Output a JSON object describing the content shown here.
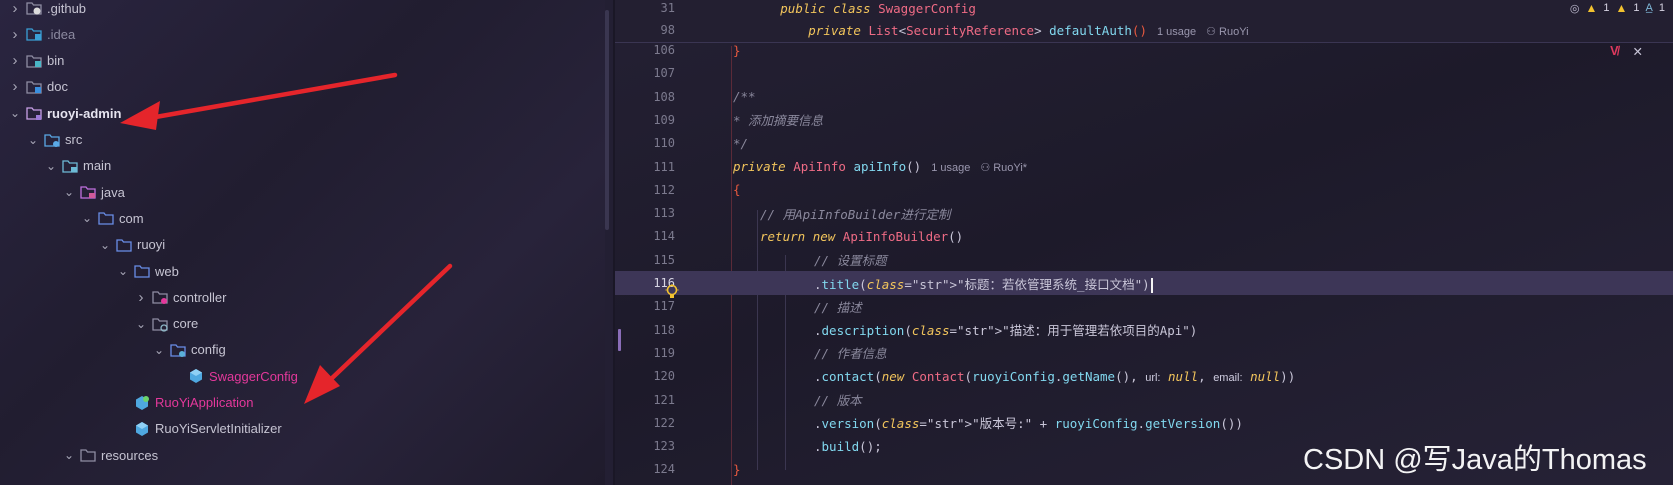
{
  "tree": {
    "items": [
      {
        "label": ".github",
        "icon": "folder-github-icon",
        "chev": "›",
        "style": "gray"
      },
      {
        "label": ".idea",
        "icon": "folder-idea-icon",
        "chev": "›",
        "style": "dim"
      },
      {
        "label": "bin",
        "icon": "folder-bin-icon",
        "chev": "›",
        "style": "gray"
      },
      {
        "label": "doc",
        "icon": "folder-doc-icon",
        "chev": "›",
        "style": "gray"
      },
      {
        "label": "ruoyi-admin",
        "icon": "module-folder-icon",
        "chev": "⌄",
        "style": "bold"
      },
      {
        "label": "src",
        "icon": "source-folder-icon",
        "chev": "⌄",
        "style": "gray"
      },
      {
        "label": "main",
        "icon": "main-folder-icon",
        "chev": "⌄",
        "style": "gray"
      },
      {
        "label": "java",
        "icon": "java-folder-icon",
        "chev": "⌄",
        "style": "gray"
      },
      {
        "label": "com",
        "icon": "package-icon",
        "chev": "⌄",
        "style": "gray"
      },
      {
        "label": "ruoyi",
        "icon": "package-icon",
        "chev": "⌄",
        "style": "gray"
      },
      {
        "label": "web",
        "icon": "package-icon",
        "chev": "⌄",
        "style": "gray"
      },
      {
        "label": "controller",
        "icon": "controller-folder-icon",
        "chev": "›",
        "style": "gray"
      },
      {
        "label": "core",
        "icon": "core-folder-icon",
        "chev": "⌄",
        "style": "gray"
      },
      {
        "label": "config",
        "icon": "config-folder-icon",
        "chev": "⌄",
        "style": "gray"
      },
      {
        "label": "SwaggerConfig",
        "icon": "class-icon",
        "chev": "",
        "style": "pink"
      },
      {
        "label": "RuoYiApplication",
        "icon": "spring-class-icon",
        "chev": "",
        "style": "pink"
      },
      {
        "label": "RuoYiServletInitializer",
        "icon": "class-icon",
        "chev": "",
        "style": "gray"
      },
      {
        "label": "resources",
        "icon": "resources-folder-icon",
        "chev": "⌄",
        "style": "gray"
      }
    ]
  },
  "editor": {
    "warnings": {
      "count_a": "1",
      "count_b": "1",
      "count_c": "1"
    },
    "sticky": [
      {
        "num": "31",
        "text": "public class SwaggerConfig"
      },
      {
        "num": "98",
        "text": "private List<SecurityReference> defaultAuth()",
        "usage": "1 usage",
        "author": "RuoYi"
      }
    ],
    "lines": [
      {
        "num": "106",
        "text": "}"
      },
      {
        "num": "107",
        "text": ""
      },
      {
        "num": "108",
        "text": "/**"
      },
      {
        "num": "109",
        "text": " * 添加摘要信息"
      },
      {
        "num": "110",
        "text": " */"
      },
      {
        "num": "111",
        "text": "private ApiInfo apiInfo()",
        "usage": "1 usage",
        "author": "RuoYi*"
      },
      {
        "num": "112",
        "text": "{"
      },
      {
        "num": "113",
        "text": "// 用ApiInfoBuilder进行定制"
      },
      {
        "num": "114",
        "text": "return new ApiInfoBuilder()"
      },
      {
        "num": "115",
        "text": "// 设置标题"
      },
      {
        "num": "116",
        "text": ".title(\"标题：若依管理系统_接口文档\")"
      },
      {
        "num": "117",
        "text": "// 描述"
      },
      {
        "num": "118",
        "text": ".description(\"描述：用于管理若依项目的Api\")"
      },
      {
        "num": "119",
        "text": "// 作者信息"
      },
      {
        "num": "120",
        "text": ".contact(new Contact(ruoyiConfig.getName(), url: null, email: null))"
      },
      {
        "num": "121",
        "text": "// 版本"
      },
      {
        "num": "122",
        "text": ".version(\"版本号:\" + ruoyiConfig.getVersion())"
      },
      {
        "num": "123",
        "text": ".build();"
      },
      {
        "num": "124",
        "text": "}"
      }
    ],
    "param_labels": {
      "url": "url:",
      "email": "email:"
    },
    "values": {
      "null": "null"
    }
  },
  "watermark": "CSDN @写Java的Thomas",
  "colors": {
    "accent_pink": "#e4389b",
    "arrow_red": "#e5252b",
    "current_line": "#3d3657"
  }
}
